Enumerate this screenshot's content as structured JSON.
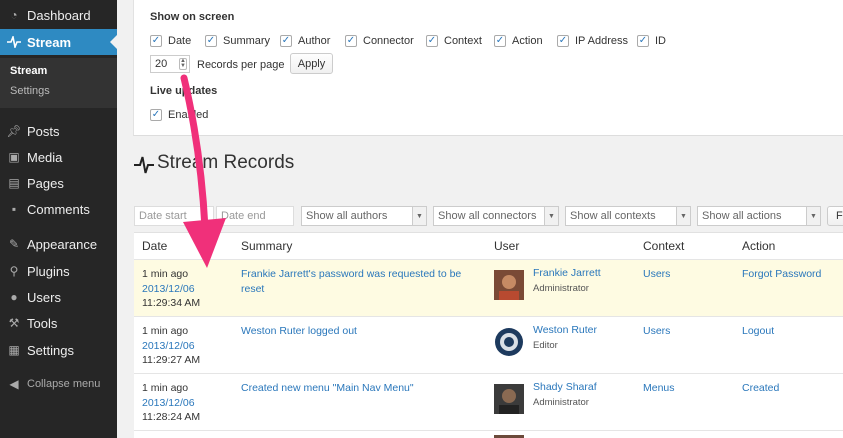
{
  "sidebar": {
    "items": [
      {
        "label": "Dashboard",
        "icon": "dashboard-icon"
      },
      {
        "label": "Stream",
        "icon": "stream-icon"
      },
      {
        "label": "Posts",
        "icon": "pin-icon"
      },
      {
        "label": "Media",
        "icon": "media-icon"
      },
      {
        "label": "Pages",
        "icon": "pages-icon"
      },
      {
        "label": "Comments",
        "icon": "comment-icon"
      },
      {
        "label": "Appearance",
        "icon": "brush-icon"
      },
      {
        "label": "Plugins",
        "icon": "plug-icon"
      },
      {
        "label": "Users",
        "icon": "users-icon"
      },
      {
        "label": "Tools",
        "icon": "wrench-icon"
      },
      {
        "label": "Settings",
        "icon": "settings-icon"
      }
    ],
    "submenu": [
      "Stream",
      "Settings"
    ],
    "collapse_label": "Collapse menu"
  },
  "screen_options": {
    "heading": "Show on screen",
    "columns": [
      "Date",
      "Summary",
      "Author",
      "Connector",
      "Context",
      "Action",
      "IP Address",
      "ID"
    ],
    "per_page_value": "20",
    "per_page_label": "Records per page",
    "apply_label": "Apply",
    "live_heading": "Live updates",
    "enabled_label": "Enabled"
  },
  "records": {
    "title": "Stream Records",
    "filters": {
      "date_start_placeholder": "Date start",
      "date_end_placeholder": "Date end",
      "authors": "Show all authors",
      "connectors": "Show all connectors",
      "contexts": "Show all contexts",
      "actions": "Show all actions",
      "filter_button": "Fi"
    },
    "columns": [
      "Date",
      "Summary",
      "User",
      "Context",
      "Action"
    ],
    "rows": [
      {
        "ago": "1 min ago",
        "date": "2013/12/06",
        "time": "11:29:34 AM",
        "summary_line1": "Frankie Jarrett's password was requested to be",
        "summary_line2": "reset",
        "user": "Frankie Jarrett",
        "role": "Administrator",
        "context": "Users",
        "action": "Forgot Password"
      },
      {
        "ago": "1 min ago",
        "date": "2013/12/06",
        "time": "11:29:27 AM",
        "summary_line1": "Weston Ruter logged out",
        "summary_line2": "",
        "user": "Weston Ruter",
        "role": "Editor",
        "context": "Users",
        "action": "Logout"
      },
      {
        "ago": "1 min ago",
        "date": "2013/12/06",
        "time": "11:28:24 AM",
        "summary_line1": "Created new menu \"Main Nav Menu\"",
        "summary_line2": "",
        "user": "Shady Sharaf",
        "role": "Administrator",
        "context": "Menus",
        "action": "Created"
      }
    ]
  },
  "colors": {
    "accent": "#2e8ac2",
    "link": "#2a77bb",
    "highlight": "#fefbe2",
    "annotation_arrow": "#f0307a"
  }
}
